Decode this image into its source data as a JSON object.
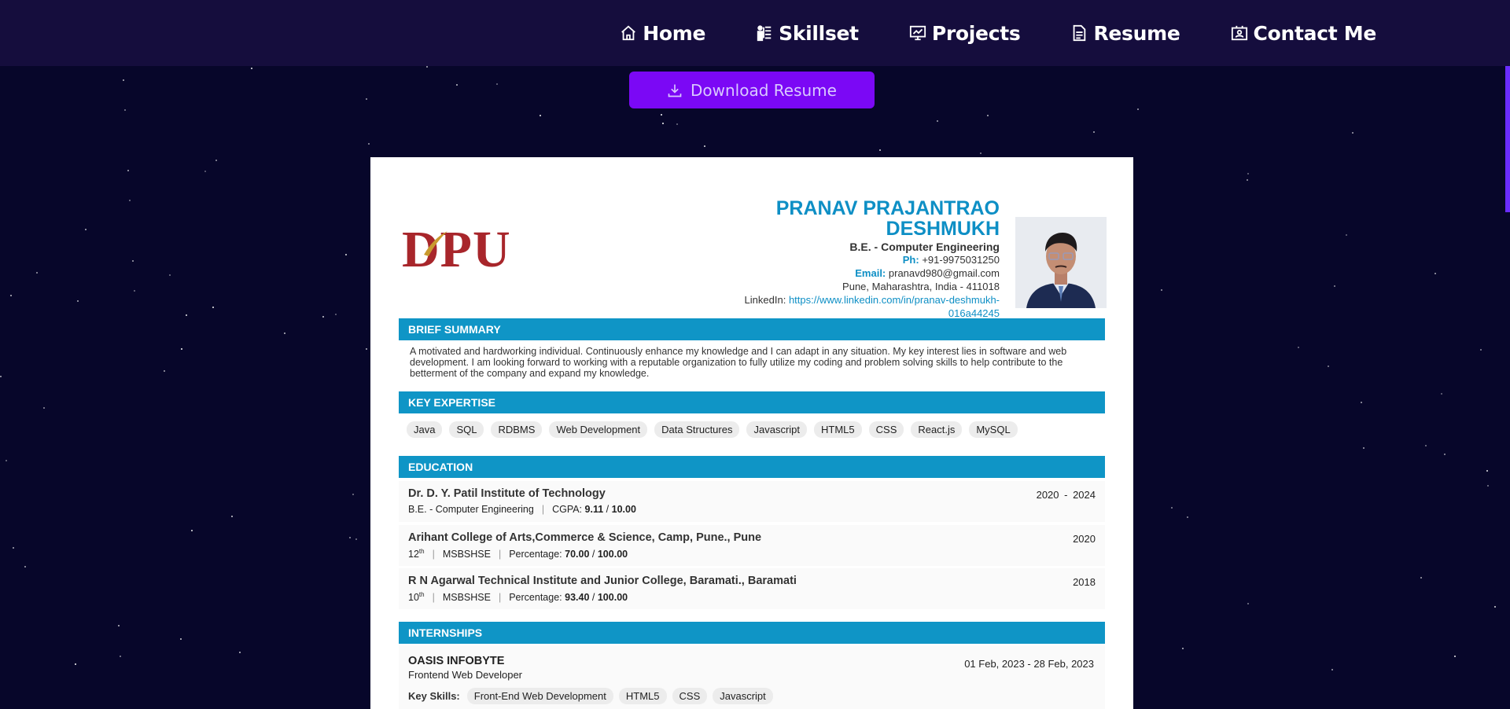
{
  "nav": {
    "items": [
      {
        "label": "Home",
        "icon": "home-icon"
      },
      {
        "label": "Skillset",
        "icon": "skillset-icon"
      },
      {
        "label": "Projects",
        "icon": "projects-icon"
      },
      {
        "label": "Resume",
        "icon": "resume-icon"
      },
      {
        "label": "Contact Me",
        "icon": "contact-icon"
      }
    ]
  },
  "download": {
    "label": "Download Resume",
    "icon": "download-icon"
  },
  "resume": {
    "logo": "DPU",
    "name_line1": "PRANAV PRAJANTRAO",
    "name_line2": "DESHMUKH",
    "degree": "B.E. - Computer Engineering",
    "phone_label": "Ph:",
    "phone": "+91-9975031250",
    "email_label": "Email:",
    "email": "pranavd980@gmail.com",
    "address": "Pune, Maharashtra, India - 411018",
    "linkedin_label": "LinkedIn:",
    "linkedin_url_1": "https://www.linkedin.com/in/pranav-deshmukh-",
    "linkedin_url_2": "016a44245",
    "sections": {
      "summary": "BRIEF SUMMARY",
      "expertise": "KEY EXPERTISE",
      "education": "EDUCATION",
      "internships": "INTERNSHIPS"
    },
    "summary_text": "A motivated and hardworking individual. Continuously enhance my knowledge and I can adapt in any situation. My key interest lies in software and web development. I am looking forward to working with a reputable organization to fully utilize my coding and problem solving skills to help contribute to the betterment of the company and expand my knowledge.",
    "skills": [
      "Java",
      "SQL",
      "RDBMS",
      "Web Development",
      "Data Structures",
      "Javascript",
      "HTML5",
      "CSS",
      "React.js",
      "MySQL"
    ],
    "education": [
      {
        "institute": "Dr. D. Y. Patil Institute of Technology",
        "year": "2020 - 2024",
        "detail1": "B.E. - Computer Engineering",
        "detail2": "CGPA:",
        "score": "9.11",
        "slash": "/",
        "max": "10.00"
      },
      {
        "institute": "Arihant College of Arts,Commerce & Science, Camp, Pune., Pune",
        "year": "2020",
        "grade": "12",
        "grade_sup": "th",
        "board": "MSBSHSE",
        "detail2": "Percentage:",
        "score": "70.00",
        "slash": "/",
        "max": "100.00"
      },
      {
        "institute": "R N Agarwal Technical Institute and Junior College, Baramati., Baramati",
        "year": "2018",
        "grade": "10",
        "grade_sup": "th",
        "board": "MSBSHSE",
        "detail2": "Percentage:",
        "score": "93.40",
        "slash": "/",
        "max": "100.00"
      }
    ],
    "internship": {
      "company": "OASIS INFOBYTE",
      "role": "Frontend Web Developer",
      "dates": "01 Feb, 2023  - 28 Feb, 2023",
      "key_skills_label": "Key Skills:",
      "skills": [
        "Front-End Web Development",
        "HTML5",
        "CSS",
        "Javascript"
      ]
    }
  }
}
